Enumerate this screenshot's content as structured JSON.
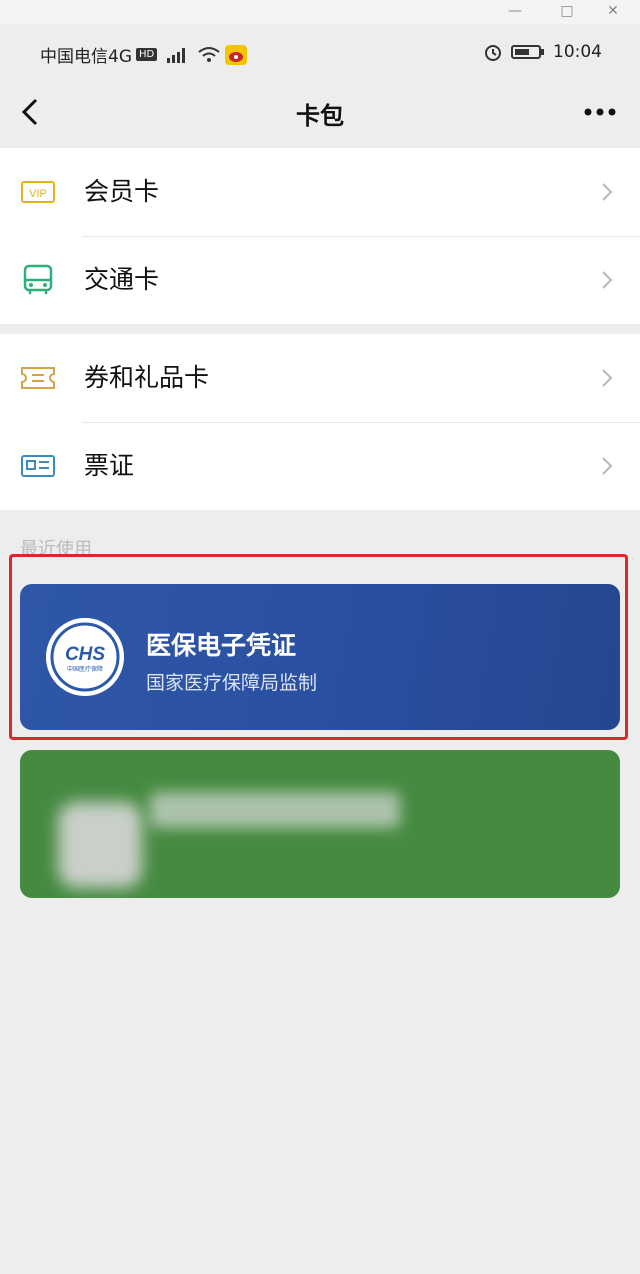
{
  "window_controls": {
    "minimize": "—",
    "maximize": "□",
    "close": "✕"
  },
  "status_bar": {
    "carrier": "中国电信4G",
    "hd_badge": "HD",
    "time": "10:04"
  },
  "nav": {
    "title": "卡包"
  },
  "group1": [
    {
      "label": "会员卡",
      "icon": "vip-card-icon",
      "color": "#e2b21c"
    },
    {
      "label": "交通卡",
      "icon": "bus-icon",
      "color": "#2fae79"
    }
  ],
  "group2": [
    {
      "label": "券和礼品卡",
      "icon": "ticket-icon",
      "color": "#d7a14a"
    },
    {
      "label": "票证",
      "icon": "id-card-icon",
      "color": "#3a8cc0"
    }
  ],
  "recent_label": "最近使用",
  "cards": {
    "chs": {
      "logo_text": "CHS",
      "logo_subtext": "中国医疗保障",
      "name": "医保电子凭证",
      "issuer": "国家医疗保障局监制",
      "color": "#2f57a8"
    },
    "green": {
      "color": "#468a41"
    }
  },
  "highlight_color": "#e0242b"
}
